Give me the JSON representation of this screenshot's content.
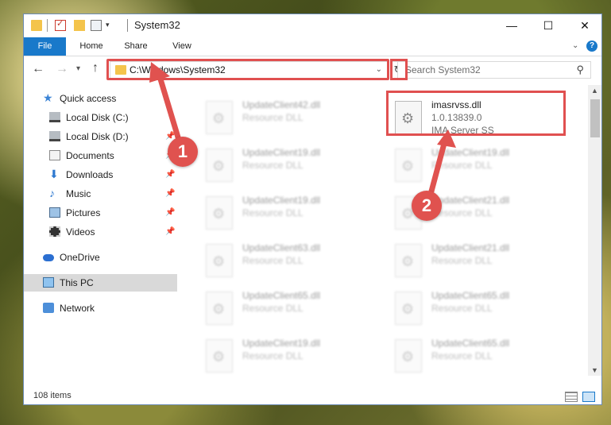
{
  "window": {
    "title": "System32",
    "controls": {
      "minimize": "—",
      "maximize": "☐",
      "close": "✕"
    }
  },
  "ribbon": {
    "tabs": [
      "File",
      "Home",
      "Share",
      "View"
    ],
    "help": "?"
  },
  "navigation": {
    "address": "C:\\Windows\\System32",
    "search_placeholder": "Search System32"
  },
  "sidebar": {
    "items": [
      {
        "label": "Quick access",
        "icon": "star-icon"
      },
      {
        "label": "Local Disk (C:)",
        "icon": "drive-icon"
      },
      {
        "label": "Local Disk (D:)",
        "icon": "drive-icon"
      },
      {
        "label": "Documents",
        "icon": "documents-icon"
      },
      {
        "label": "Downloads",
        "icon": "download-icon"
      },
      {
        "label": "Music",
        "icon": "music-icon"
      },
      {
        "label": "Pictures",
        "icon": "pictures-icon"
      },
      {
        "label": "Videos",
        "icon": "videos-icon"
      },
      {
        "label": "OneDrive",
        "icon": "cloud-icon"
      },
      {
        "label": "This PC",
        "icon": "computer-icon"
      },
      {
        "label": "Network",
        "icon": "network-icon"
      }
    ]
  },
  "files": {
    "left": [
      {
        "name": "UpdateClient42.dll",
        "desc": "Resource DLL"
      },
      {
        "name": "UpdateClient19.dll",
        "desc": "Resource DLL"
      },
      {
        "name": "UpdateClient19.dll",
        "desc": "Resource DLL"
      },
      {
        "name": "UpdateClient63.dll",
        "desc": "Resource DLL"
      },
      {
        "name": "UpdateClient65.dll",
        "desc": "Resource DLL"
      },
      {
        "name": "UpdateClient19.dll",
        "desc": "Resource DLL"
      }
    ],
    "right": [
      {
        "name": "imasrvss.dll",
        "version": "1.0.13839.0",
        "desc": "IMA Server SS"
      },
      {
        "name": "UpdateClient19.dll",
        "desc": "Resource DLL"
      },
      {
        "name": "UpdateClient21.dll",
        "desc": "Resource DLL"
      },
      {
        "name": "UpdateClient21.dll",
        "desc": "Resource DLL"
      },
      {
        "name": "UpdateClient65.dll",
        "desc": "Resource DLL"
      },
      {
        "name": "UpdateClient65.dll",
        "desc": "Resource DLL"
      }
    ]
  },
  "status": {
    "count": "108 items"
  },
  "callouts": {
    "one": "1",
    "two": "2"
  },
  "colors": {
    "accent": "#1979ca",
    "highlight": "#e05050"
  }
}
